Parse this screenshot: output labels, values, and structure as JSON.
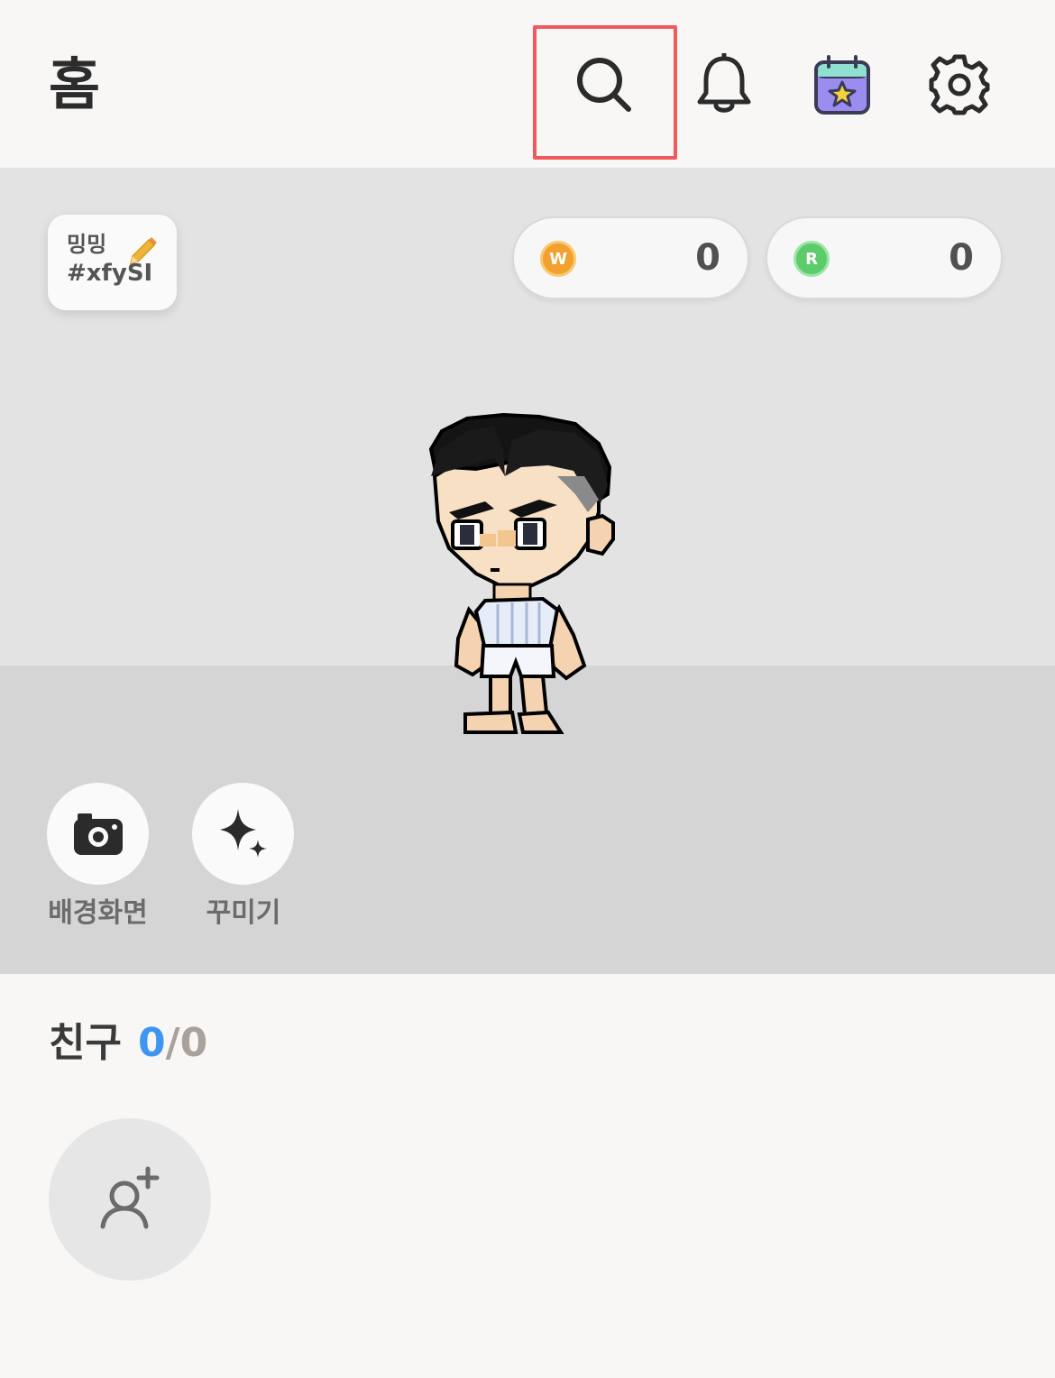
{
  "header": {
    "title": "홈",
    "icons": [
      "search-icon",
      "bell-icon",
      "calendar-star-icon",
      "gear-icon"
    ]
  },
  "profile": {
    "nickname": "밍밍",
    "tag": "#xfySI"
  },
  "currencies": [
    {
      "symbol": "W",
      "value": "0",
      "color": "#f2a12f"
    },
    {
      "symbol": "R",
      "value": "0",
      "color": "#5ccb6a"
    }
  ],
  "actions": {
    "background_label": "배경화면",
    "decorate_label": "꾸미기"
  },
  "friends": {
    "label": "친구",
    "current": "0",
    "separator": "/",
    "total": "0"
  },
  "colors": {
    "highlight": "#f05a5d",
    "accent_blue": "#3f96f0"
  }
}
